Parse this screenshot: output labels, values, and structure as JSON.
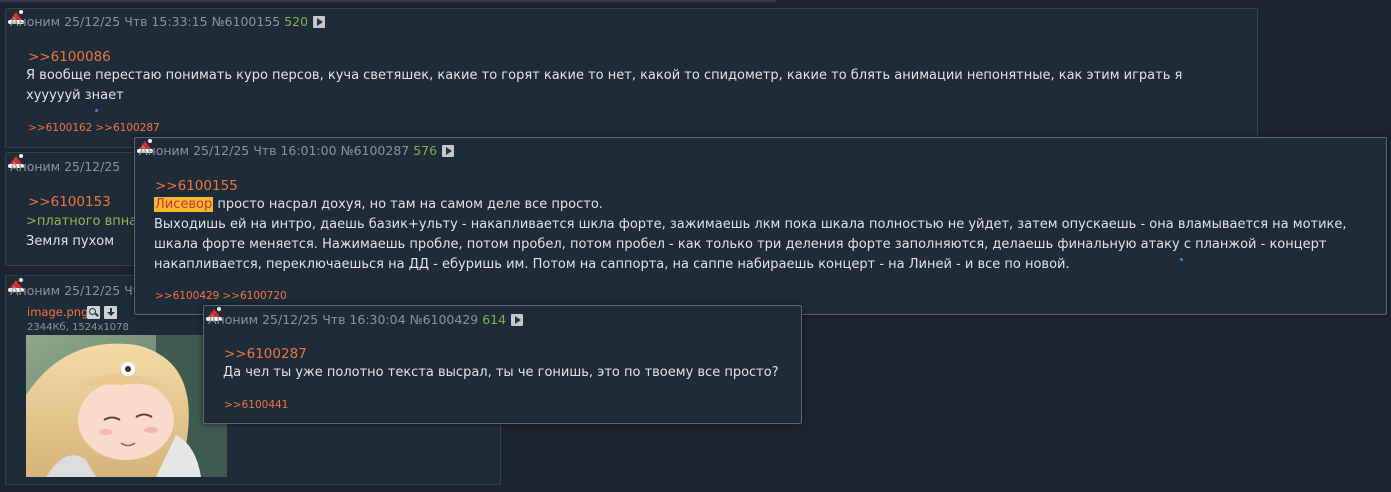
{
  "posts": [
    {
      "author": "Аноним",
      "datetime": "25/12/25 Чтв 15:33:15",
      "number": "№6100155",
      "count": "520",
      "reply_to": ">>6100086",
      "text_lines": [
        "Я вообще перестаю понимать куро персов, куча светяшек, какие то горят какие то нет, какой то спидометр, какие то блять анимации непонятные, как этим играть я",
        "хуууууй знает"
      ],
      "backlinks": [
        ">>6100162",
        ">>6100287"
      ]
    },
    {
      "author": "Аноним",
      "datetime": "25/12/25",
      "reply_to": ">>6100153",
      "greentext": ">платного впна",
      "text": "Земля пухом"
    },
    {
      "author": "Аноним",
      "datetime": "25/12/25 Чт",
      "file_name": "image.png",
      "file_meta": "2344Кб, 1524x1078"
    }
  ],
  "popups": [
    {
      "author": "Аноним",
      "datetime": "25/12/25 Чтв 16:01:00",
      "number": "№6100287",
      "count": "576",
      "reply_to": ">>6100155",
      "highlight": "Лисевор",
      "first_line_rest": " просто насрал дохуя, но там на самом деле все просто.",
      "text_lines": [
        "Выходишь ей на интро, даешь базик+ульту - накапливается шкла форте, зажимаешь лкм пока шкала полностью не уйдет, затем опускаешь - она вламывается на мотике,",
        "шкала форте меняется. Нажимаешь пробле, потом пробел, потом пробел - как только три деления форте заполняются, делаешь финальную атаку с планжой - концерт",
        "накапливается, переключаешься на ДД - ебуришь им. Потом на саппорта, на саппе набираешь концерт - на Линей - и все по новой."
      ],
      "backlinks": [
        ">>6100429",
        ">>6100720"
      ]
    },
    {
      "author": "Аноним",
      "datetime": "25/12/25 Чтв 16:30:04",
      "number": "№6100429",
      "count": "614",
      "reply_to": ">>6100287",
      "text": "Да чел ты уже полотно текста высрал, ты че гонишь, это по твоему все просто?",
      "backlinks": [
        ">>6100441"
      ]
    }
  ],
  "icons": [
    "santa-hat-icon",
    "play-icon",
    "search-icon",
    "download-icon"
  ],
  "colors": {
    "background": "#1b2530",
    "post_background": "#1e2b38",
    "link": "#f1743b",
    "greentext": "#8fb94b",
    "count": "#7fb24b",
    "highlight_bg": "#f5b82e"
  }
}
